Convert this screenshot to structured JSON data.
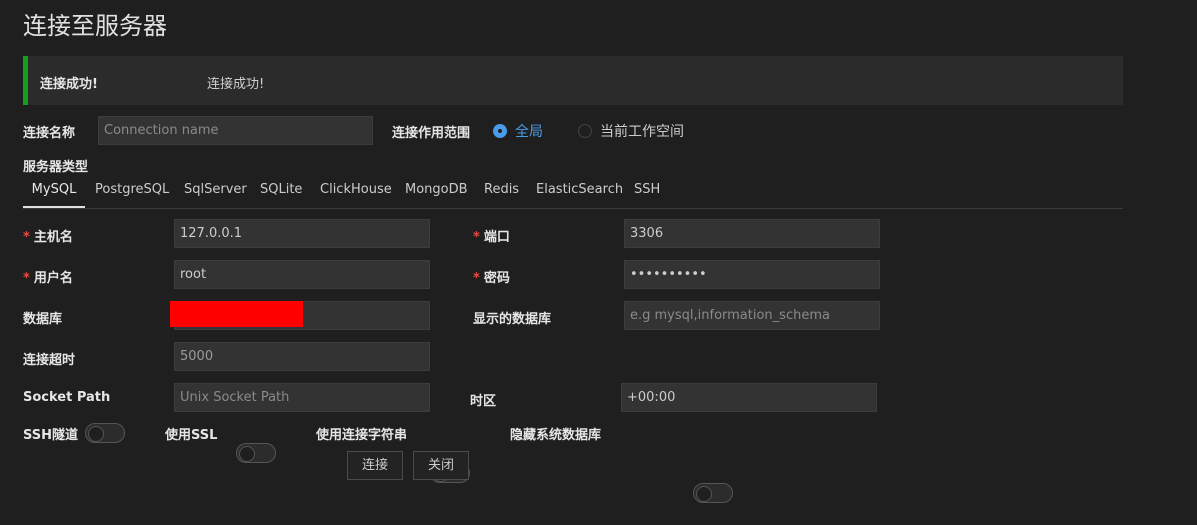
{
  "page": {
    "title": "连接至服务器"
  },
  "alert": {
    "title": "连接成功!",
    "message": "连接成功!",
    "color": "#12a11e"
  },
  "connection_name": {
    "label": "连接名称",
    "placeholder": "Connection name",
    "value": ""
  },
  "scope": {
    "label": "连接作用范围",
    "options": [
      "全局",
      "当前工作空间"
    ],
    "selected": "全局"
  },
  "server_type": {
    "label": "服务器类型",
    "tabs": [
      "MySQL",
      "PostgreSQL",
      "SqlServer",
      "SQLite",
      "ClickHouse",
      "MongoDB",
      "Redis",
      "ElasticSearch",
      "SSH"
    ],
    "active": "MySQL"
  },
  "fields": {
    "host": {
      "label": "主机名",
      "value": "127.0.0.1",
      "required": true
    },
    "port": {
      "label": "端口",
      "value": "3306",
      "required": true
    },
    "user": {
      "label": "用户名",
      "value": "root",
      "required": true
    },
    "password": {
      "label": "密码",
      "value": "••••••••••",
      "required": true
    },
    "database": {
      "label": "数据库",
      "value": ""
    },
    "show_databases": {
      "label": "显示的数据库",
      "placeholder": "e.g mysql,information_schema",
      "value": ""
    },
    "timeout": {
      "label": "连接超时",
      "value": "5000"
    },
    "socket_path": {
      "label": "Socket Path",
      "placeholder": "Unix Socket Path",
      "value": ""
    },
    "timezone": {
      "label": "时区",
      "value": "+00:00"
    }
  },
  "toggles": {
    "ssh_tunnel": {
      "label": "SSH隧道",
      "on": false
    },
    "use_ssl": {
      "label": "使用SSL",
      "on": false
    },
    "use_conn_string": {
      "label": "使用连接字符串",
      "on": false
    },
    "hide_system_db": {
      "label": "隐藏系统数据库",
      "on": false
    }
  },
  "actions": {
    "connect": "连接",
    "close": "关闭"
  },
  "colors": {
    "background": "#1f1f1f",
    "accent": "#4a9be8",
    "required": "#e74c3c",
    "redaction": "#ff0000"
  }
}
